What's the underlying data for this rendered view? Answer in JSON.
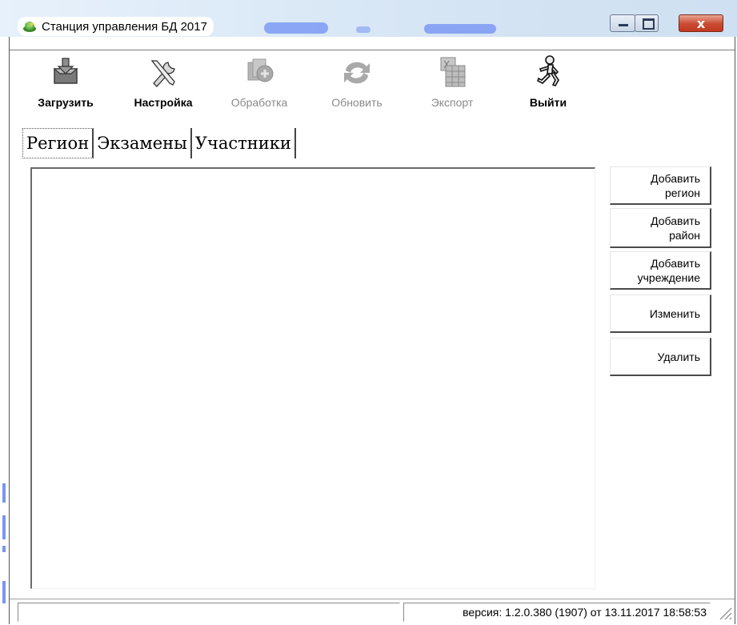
{
  "window": {
    "title": "Станция управления БД 2017",
    "close_glyph": "x"
  },
  "toolbar": {
    "items": [
      {
        "label": "Загрузить",
        "icon": "inbox-download-icon",
        "enabled": true
      },
      {
        "label": "Настройка",
        "icon": "tools-icon",
        "enabled": true
      },
      {
        "label": "Обработка",
        "icon": "process-documents-icon",
        "enabled": false
      },
      {
        "label": "Обновить",
        "icon": "refresh-icon",
        "enabled": false
      },
      {
        "label": "Экспорт",
        "icon": "excel-export-icon",
        "enabled": false
      },
      {
        "label": "Выйти",
        "icon": "running-man-exit-icon",
        "enabled": true
      }
    ]
  },
  "tabs": [
    {
      "label": "Регион",
      "active": true
    },
    {
      "label": "Экзамены",
      "active": false
    },
    {
      "label": "Участники",
      "active": false
    }
  ],
  "side_buttons": {
    "add_region": [
      "Добавить",
      "регион"
    ],
    "add_district": [
      "Добавить",
      "район"
    ],
    "add_institution": [
      "Добавить",
      "учреждение"
    ],
    "edit": "Изменить",
    "delete": "Удалить"
  },
  "status": {
    "version_text": "версия: 1.2.0.380 (1907) от 13.11.2017 18:58:53"
  },
  "colors": {
    "title_blob": "#6f8ff3",
    "close_button": "#c94a31",
    "disabled_text": "#8a8a8a"
  }
}
